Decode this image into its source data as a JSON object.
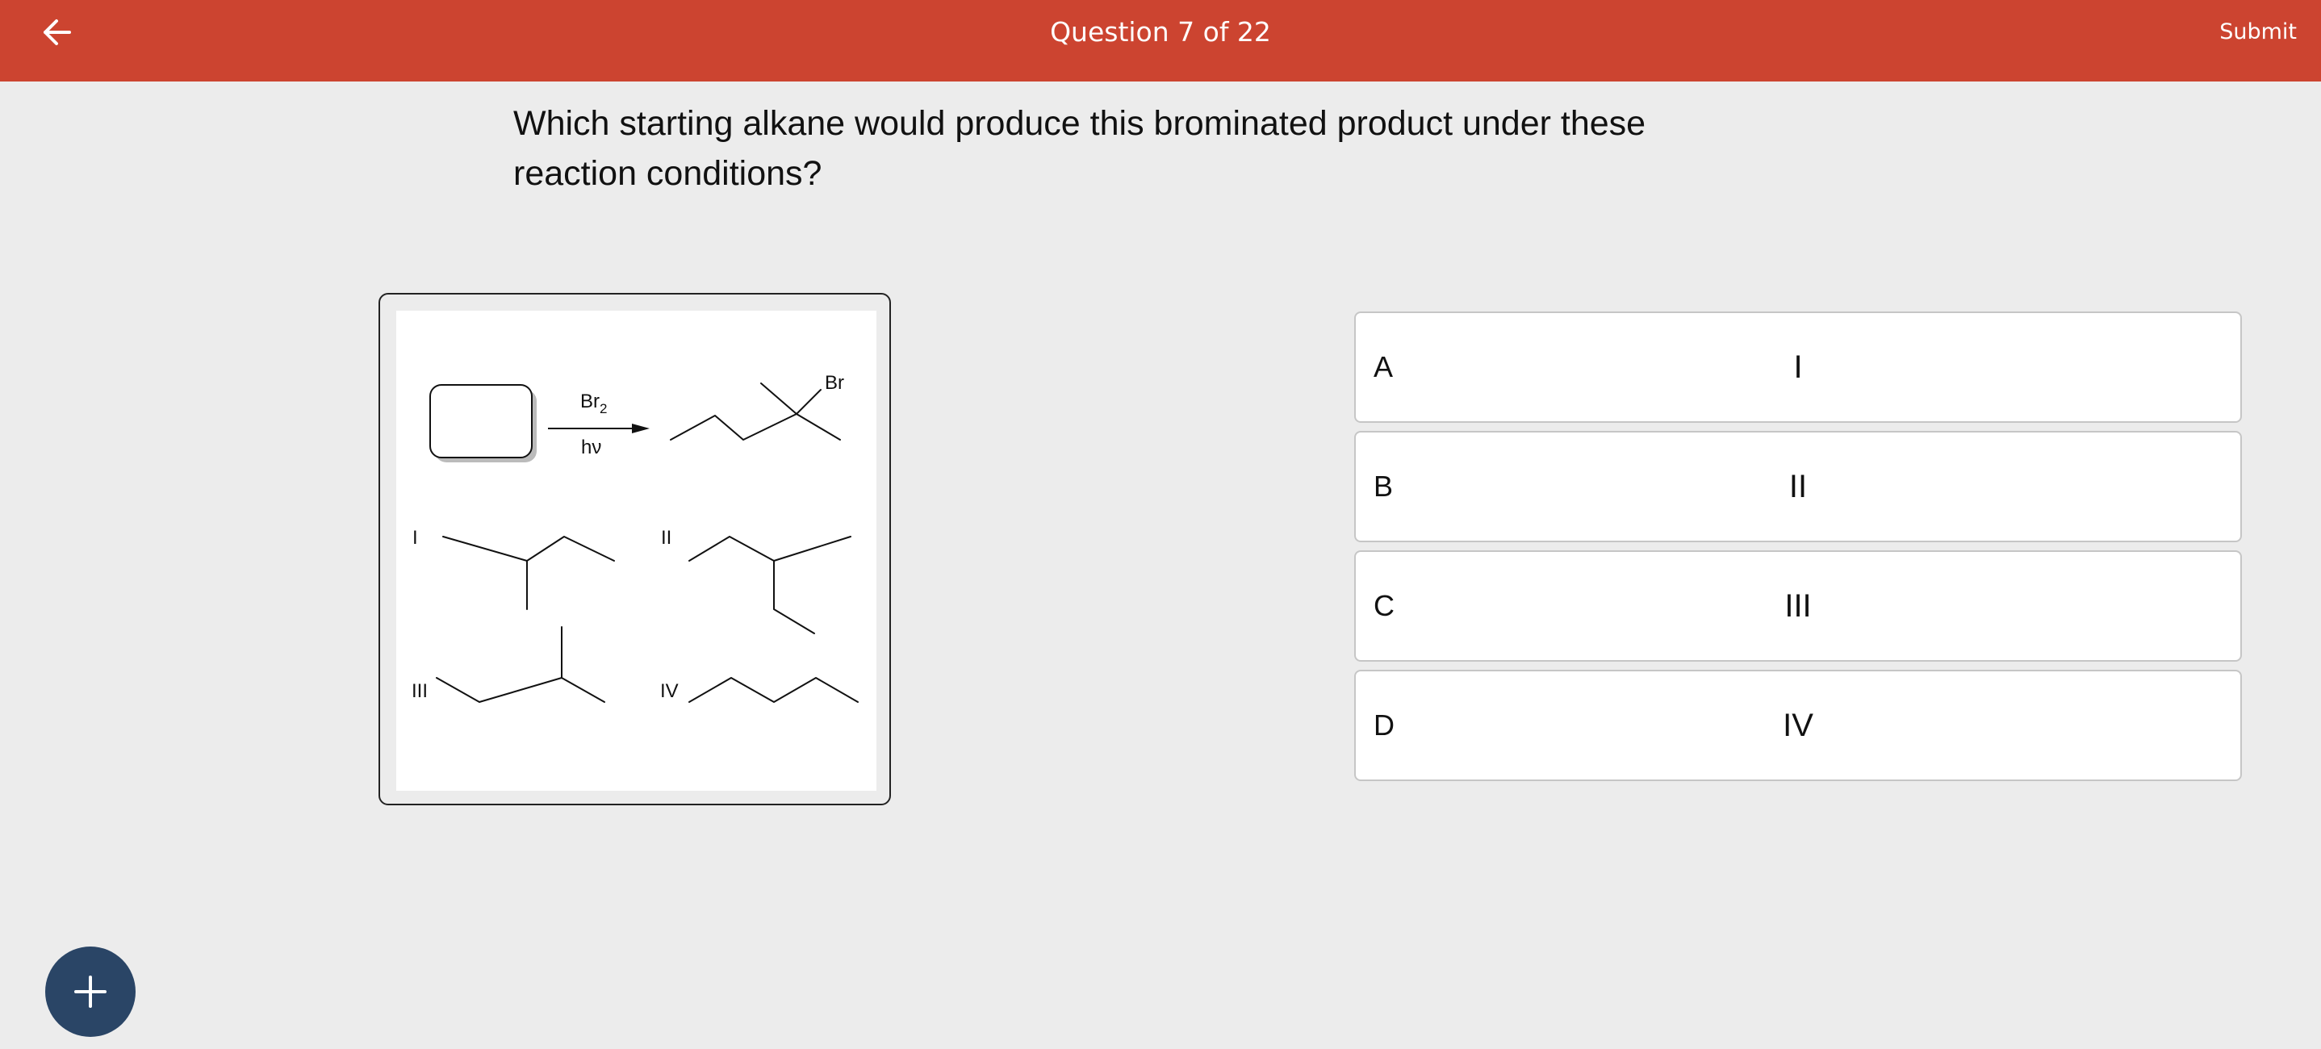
{
  "header": {
    "title": "Question 7 of 22",
    "submit_label": "Submit",
    "back_icon": "arrow-left-icon",
    "background_color": "#cc4430"
  },
  "question": {
    "text": "Which starting alkane would produce this brominated product under these reaction conditions?"
  },
  "figure": {
    "reagent_main": "Br",
    "reagent_subscript": "2",
    "conditions": "hν",
    "product_label": "Br",
    "structure_labels": [
      "I",
      "II",
      "III",
      "IV"
    ]
  },
  "options": [
    {
      "letter": "A",
      "text": "I"
    },
    {
      "letter": "B",
      "text": "II"
    },
    {
      "letter": "C",
      "text": "III"
    },
    {
      "letter": "D",
      "text": "IV"
    }
  ],
  "fab": {
    "icon": "plus-icon",
    "color": "#2a4566"
  }
}
